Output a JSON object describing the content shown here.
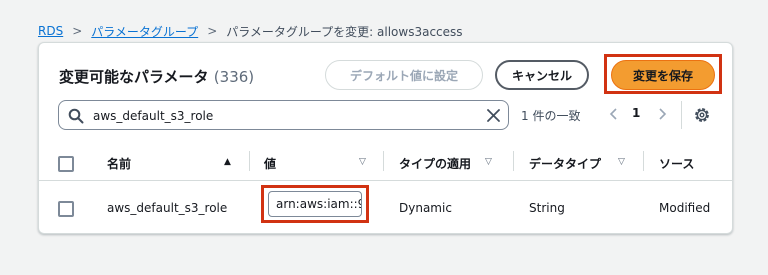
{
  "breadcrumb": {
    "root": "RDS",
    "parent": "パラメータグループ",
    "current": "パラメータグループを変更: allows3access"
  },
  "panel": {
    "title": "変更可能なパラメータ",
    "count": "(336)",
    "reset_label": "デフォルト値に設定",
    "cancel_label": "キャンセル",
    "save_label": "変更を保存"
  },
  "search": {
    "value": "aws_default_s3_role"
  },
  "pagination": {
    "matches": "1 件の一致",
    "page": "1"
  },
  "table": {
    "headers": {
      "name": "名前",
      "value": "値",
      "apply_type": "タイプの適用",
      "data_type": "データタイプ",
      "source": "ソース"
    },
    "rows": [
      {
        "name": "aws_default_s3_role",
        "value": "arn:aws:iam::9",
        "apply_type": "Dynamic",
        "data_type": "String",
        "source": "Modified"
      }
    ]
  },
  "colors": {
    "link": "#0972d3",
    "primary": "#f39c30",
    "highlight": "#d13212"
  },
  "icons": [
    "search-icon",
    "clear-icon",
    "chevron-left-icon",
    "chevron-right-icon",
    "settings-icon",
    "sort-ascending-icon",
    "sort-icon"
  ]
}
